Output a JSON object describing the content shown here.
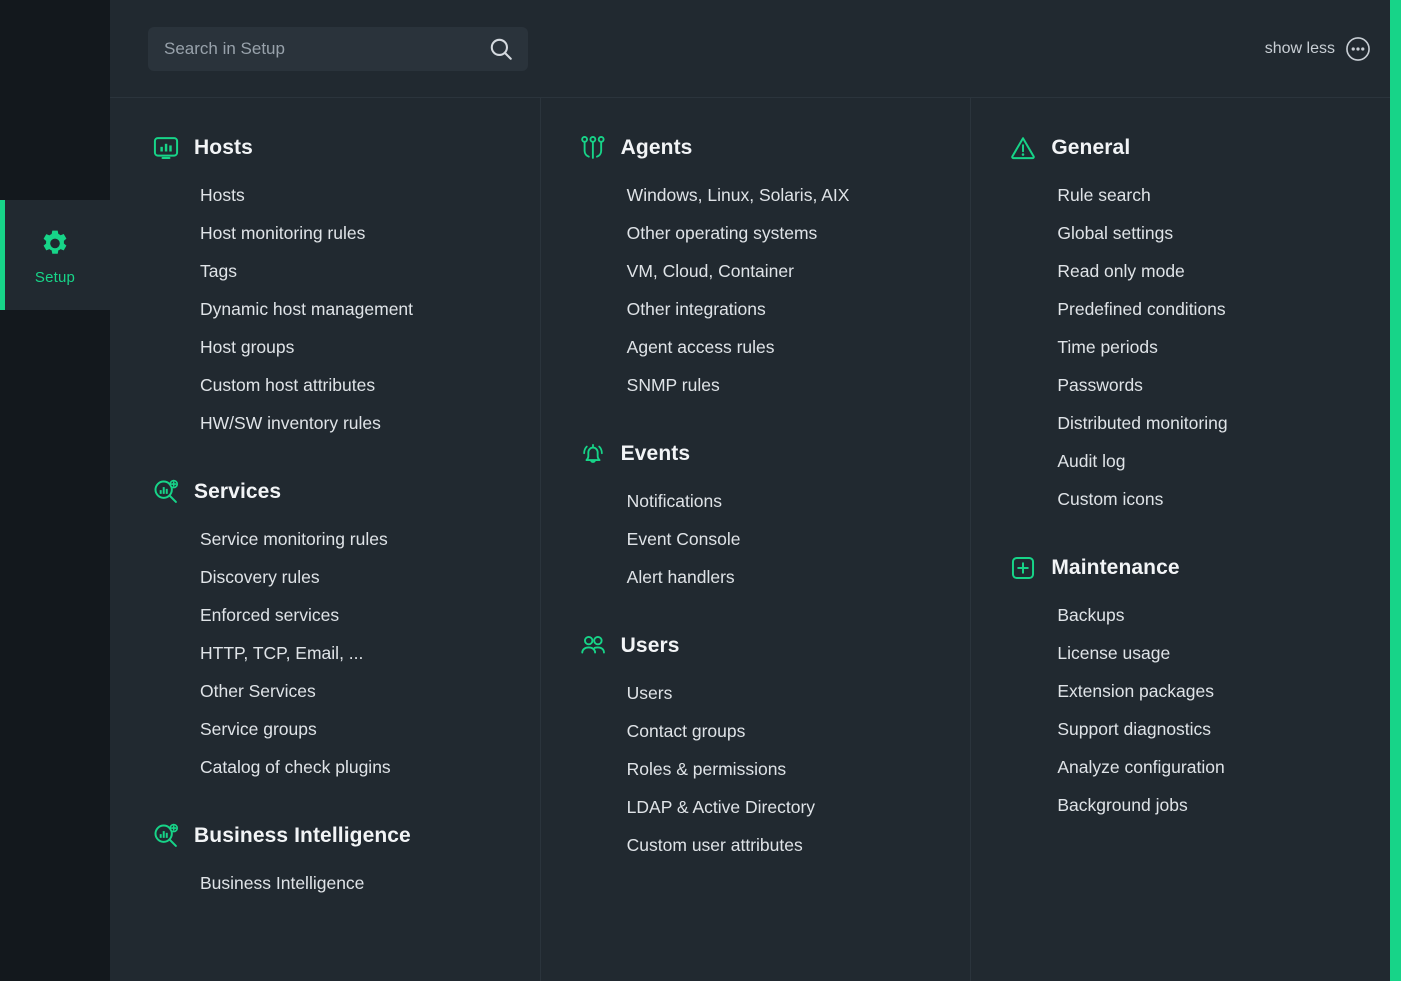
{
  "sidebar": {
    "items": [
      {
        "label": "Setup",
        "icon": "gear-icon",
        "active": true
      }
    ]
  },
  "topbar": {
    "search": {
      "placeholder": "Search in Setup",
      "value": "",
      "icon": "search-icon"
    },
    "show_less_label": "show less",
    "more_icon": "ellipsis-circle-icon"
  },
  "colors": {
    "accent": "#17d488",
    "page_background": "#212930",
    "sidebar_background": "#13181d",
    "panel_background": "#2a333b",
    "divider": "#2b343c",
    "text_primary": "#dfe3e7",
    "text_heading": "#f2f4f6",
    "text_muted": "#98a2ab"
  },
  "columns": [
    {
      "groups": [
        {
          "title": "Hosts",
          "icon": "host-monitor-icon",
          "items": [
            "Hosts",
            "Host monitoring rules",
            "Tags",
            "Dynamic host management",
            "Host groups",
            "Custom host attributes",
            "HW/SW inventory rules"
          ]
        },
        {
          "title": "Services",
          "icon": "service-search-plus-icon",
          "items": [
            "Service monitoring rules",
            "Discovery rules",
            "Enforced services",
            "HTTP, TCP, Email, ...",
            "Other Services",
            "Service groups",
            "Catalog of check plugins"
          ]
        },
        {
          "title": "Business Intelligence",
          "icon": "service-search-plus-icon",
          "items": [
            "Business Intelligence"
          ]
        }
      ]
    },
    {
      "groups": [
        {
          "title": "Agents",
          "icon": "agents-circuit-icon",
          "items": [
            "Windows, Linux, Solaris, AIX",
            "Other operating systems",
            "VM, Cloud, Container",
            "Other integrations",
            "Agent access rules",
            "SNMP rules"
          ]
        },
        {
          "title": "Events",
          "icon": "bell-icon",
          "items": [
            "Notifications",
            "Event Console",
            "Alert handlers"
          ]
        },
        {
          "title": "Users",
          "icon": "users-icon",
          "items": [
            "Users",
            "Contact groups",
            "Roles & permissions",
            "LDAP & Active Directory",
            "Custom user attributes"
          ]
        }
      ]
    },
    {
      "groups": [
        {
          "title": "General",
          "icon": "warning-triangle-icon",
          "items": [
            "Rule search",
            "Global settings",
            "Read only mode",
            "Predefined conditions",
            "Time periods",
            "Passwords",
            "Distributed monitoring",
            "Audit log",
            "Custom icons"
          ]
        },
        {
          "title": "Maintenance",
          "icon": "plus-square-icon",
          "items": [
            "Backups",
            "License usage",
            "Extension packages",
            "Support diagnostics",
            "Analyze configuration",
            "Background jobs"
          ]
        }
      ]
    }
  ]
}
